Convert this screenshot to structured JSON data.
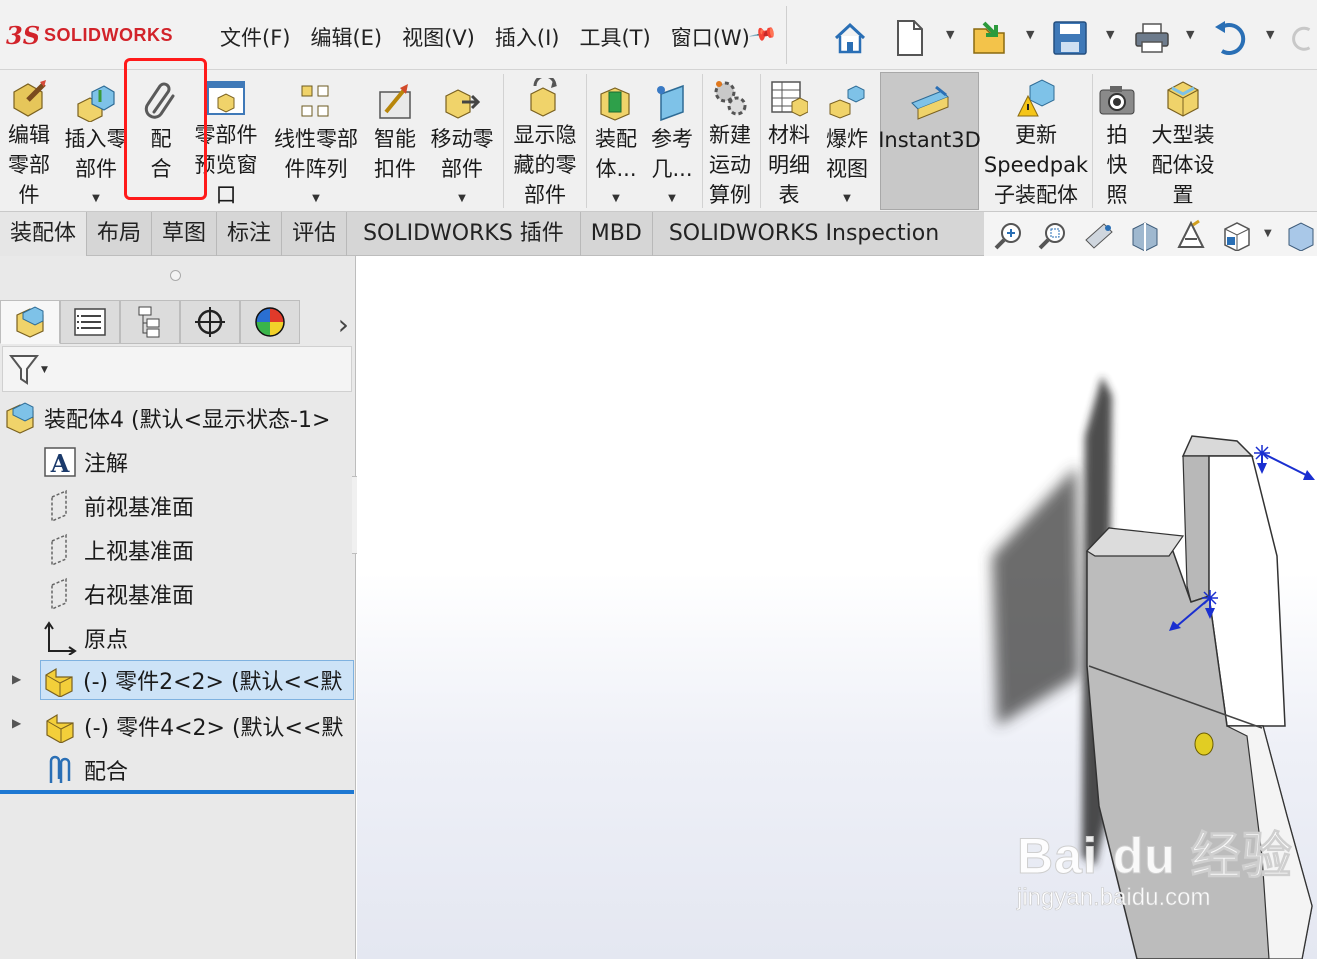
{
  "app": {
    "logo_ds": "3S",
    "logo_name": "SOLIDWORKS"
  },
  "menu": [
    "文件(F)",
    "编辑(E)",
    "视图(V)",
    "插入(I)",
    "工具(T)",
    "窗口(W)"
  ],
  "quick_access": [
    "home-icon",
    "new-document-icon",
    "open-icon",
    "save-icon",
    "print-icon",
    "undo-icon",
    "redo-icon"
  ],
  "ribbon": {
    "buttons": [
      {
        "label": "编辑\n零部\n件"
      },
      {
        "label": "插入零\n部件"
      },
      {
        "label": "配\n合"
      },
      {
        "label": "零部件\n预览窗\n口"
      },
      {
        "label": "线性零部\n件阵列"
      },
      {
        "label": "智能\n扣件"
      },
      {
        "label": "移动零\n部件"
      },
      {
        "label": "显示隐\n藏的零\n部件"
      },
      {
        "label": "装配\n体..."
      },
      {
        "label": "参考\n几..."
      },
      {
        "label": "新建\n运动\n算例"
      },
      {
        "label": "材料\n明细\n表"
      },
      {
        "label": "爆炸\n视图"
      },
      {
        "label": "Instant3D"
      },
      {
        "label": "更新\nSpeedpak\n子装配体"
      },
      {
        "label": "拍\n快\n照"
      },
      {
        "label": "大型装\n配体设\n置"
      }
    ],
    "highlight_color": "#ff1a1a"
  },
  "tabs": [
    "装配体",
    "布局",
    "草图",
    "标注",
    "评估",
    "SOLIDWORKS 插件",
    "MBD",
    "SOLIDWORKS Inspection"
  ],
  "feature_manager": {
    "root": "装配体4  (默认<显示状态-1>",
    "items": [
      {
        "label": "注解",
        "icon": "annotation-icon"
      },
      {
        "label": "前视基准面",
        "icon": "plane-icon"
      },
      {
        "label": "上视基准面",
        "icon": "plane-icon"
      },
      {
        "label": "右视基准面",
        "icon": "plane-icon"
      },
      {
        "label": "原点",
        "icon": "origin-icon"
      },
      {
        "label": "(-) 零件2<2> (默认<<默",
        "icon": "part-icon"
      },
      {
        "label": "(-) 零件4<2> (默认<<默",
        "icon": "part-icon"
      },
      {
        "label": "配合",
        "icon": "mate-icon"
      }
    ]
  },
  "watermark": {
    "brand": "Bai du 经验",
    "url": "jingyan.baidu.com"
  }
}
